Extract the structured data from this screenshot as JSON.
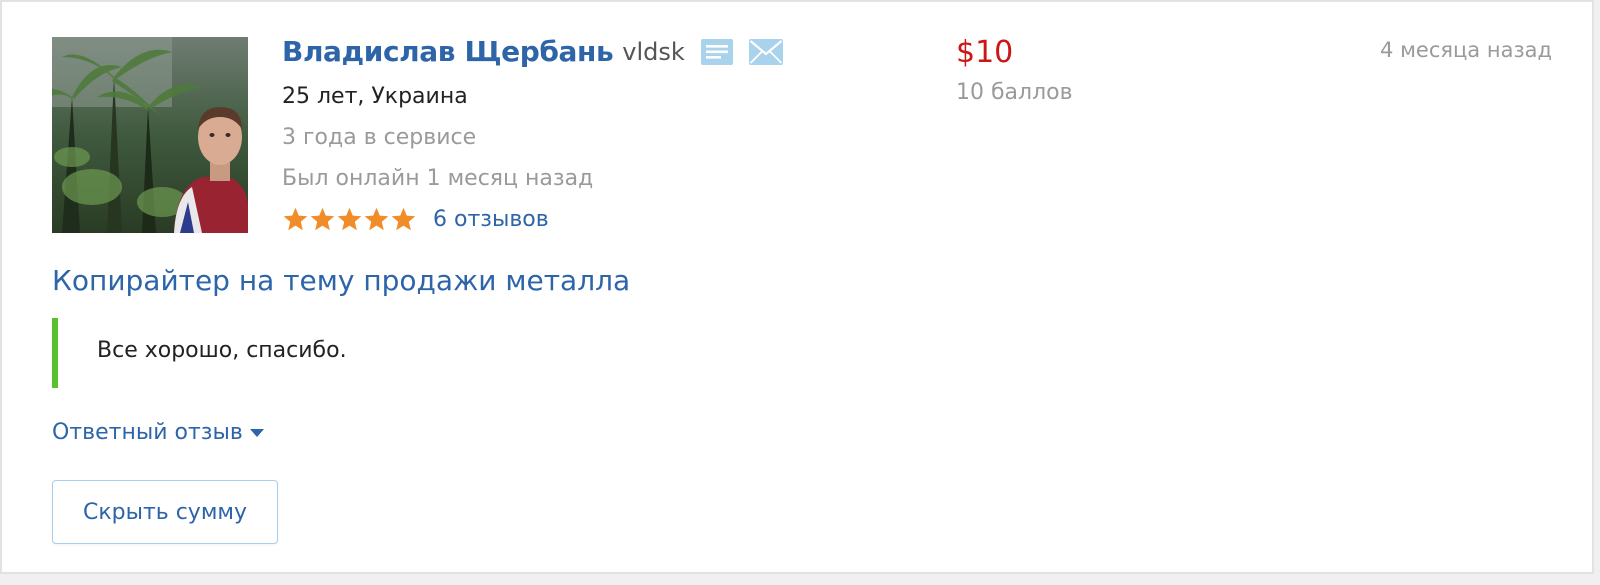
{
  "reviewer": {
    "name": "Владислав Щербань",
    "login": "vldsk",
    "age_country": "25 лет, Украина",
    "service_time": "3 года в сервисе",
    "last_online": "Был онлайн 1 месяц назад",
    "rating_stars": 5,
    "reviews_count_label": "6 отзывов"
  },
  "icons": {
    "portfolio": "document-lines-icon",
    "message": "envelope-icon",
    "star": "star-icon",
    "toggle": "caret-down-icon"
  },
  "order": {
    "price": "$10",
    "points": "10 баллов",
    "date": "4 месяца назад",
    "title": "Копирайтер на тему продажи металла"
  },
  "review": {
    "text": "Все хорошо, спасибо."
  },
  "reply_toggle_label": "Ответный отзыв",
  "hide_amount_button": "Скрыть сумму",
  "colors": {
    "link": "#2e64a8",
    "price": "#cc1616",
    "muted": "#9a9a9a",
    "star": "#f28c28",
    "quote_border": "#5ac12e",
    "icon": "#a9d2ec"
  }
}
